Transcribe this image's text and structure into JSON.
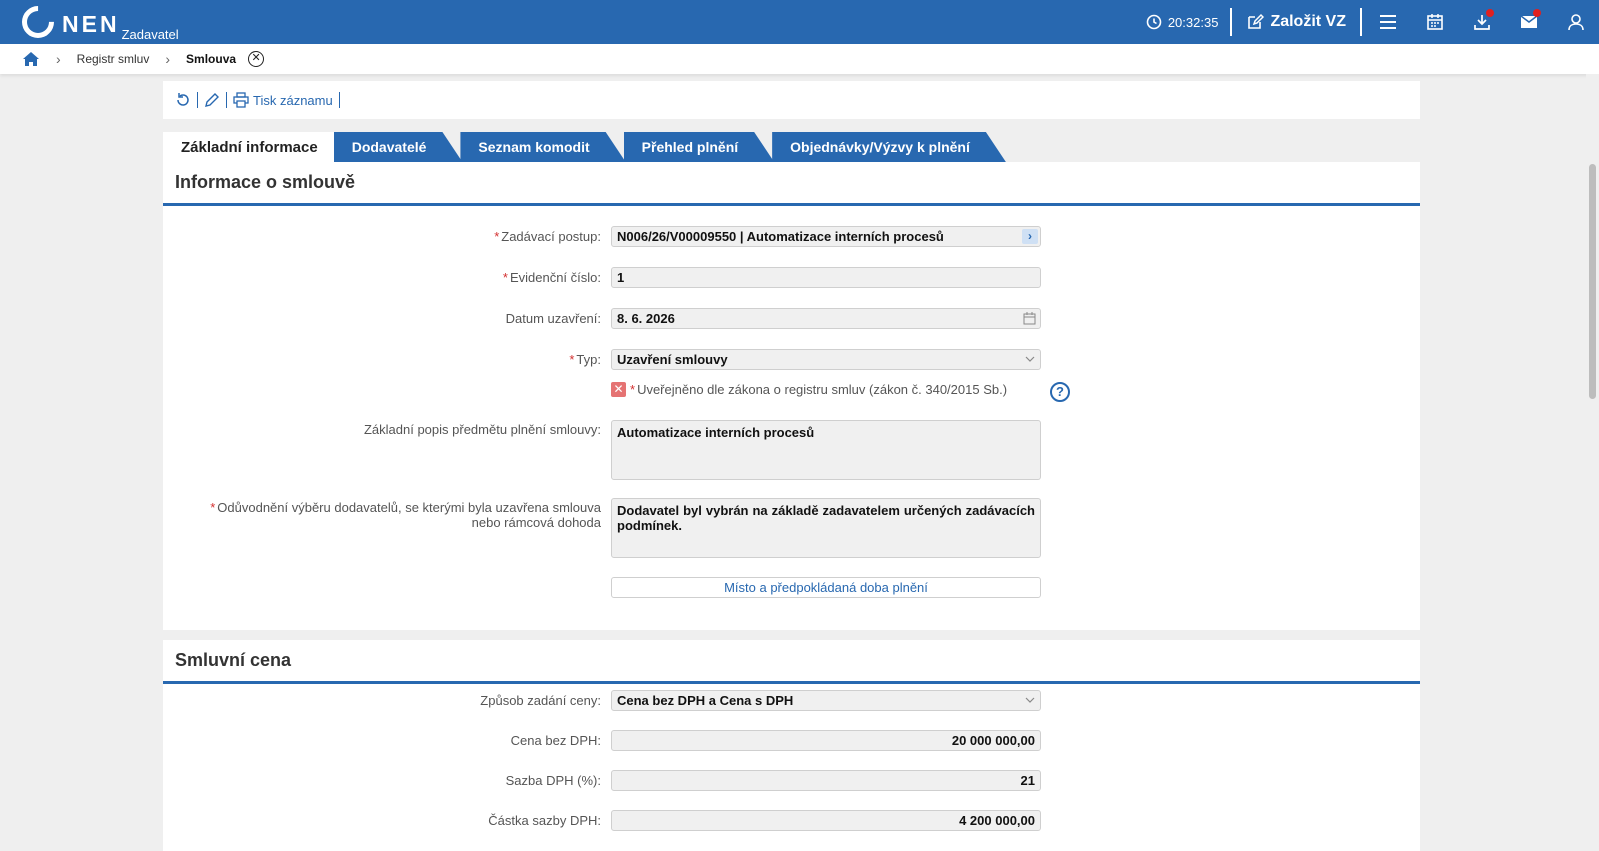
{
  "app": {
    "logo_text": "NEN",
    "logo_sub": "Zadavatel"
  },
  "topbar": {
    "clock": "20:32:35",
    "create_label": "Založit VZ",
    "icons": [
      "clock-icon",
      "edit-icon",
      "menu-icon",
      "calendar-icon",
      "download-icon",
      "mail-icon",
      "user-icon"
    ],
    "accent": "#2868b0",
    "badge_color": "#e02020"
  },
  "breadcrumb": {
    "items": [
      "Registr smluv",
      "Smlouva"
    ]
  },
  "toolbar": {
    "print_label": "Tisk záznamu"
  },
  "tabs": [
    {
      "label": "Základní informace",
      "active": true
    },
    {
      "label": "Dodavatelé",
      "active": false
    },
    {
      "label": "Seznam komodit",
      "active": false
    },
    {
      "label": "Přehled plnění",
      "active": false
    },
    {
      "label": "Objednávky/Výzvy k plnění",
      "active": false
    }
  ],
  "contract_info": {
    "title": "Informace o smlouvě",
    "procedure_label": "Zadávací postup:",
    "procedure_value": "N006/26/V00009550 | Automatizace interních procesů",
    "evidence_label": "Evidenční číslo:",
    "evidence_value": "1",
    "date_label": "Datum uzavření:",
    "date_value": "8. 6. 2026",
    "type_label": "Typ:",
    "type_value": "Uzavření smlouvy",
    "published_label": "Uveřejněno dle zákona o registru smluv (zákon č. 340/2015 Sb.)",
    "published_checked": false,
    "description_label": "Základní popis předmětu plnění smlouvy:",
    "description_value": "Automatizace interních procesů",
    "justification_label": "Odůvodnění výběru dodavatelů, se kterými byla uzavřena smlouva nebo rámcová dohoda",
    "justification_value": "Dodavatel byl vybrán na základě zadavatelem určených zadávacích podmínek.",
    "place_button": "Místo a předpokládaná doba plnění"
  },
  "price": {
    "title": "Smluvní cena",
    "method_label": "Způsob zadání ceny:",
    "method_value": "Cena bez DPH a Cena s DPH",
    "net_label": "Cena bez DPH:",
    "net_value": "20 000 000,00",
    "vat_rate_label": "Sazba DPH (%):",
    "vat_rate_value": "21",
    "vat_amount_label": "Částka sazby DPH:",
    "vat_amount_value": "4 200 000,00"
  }
}
